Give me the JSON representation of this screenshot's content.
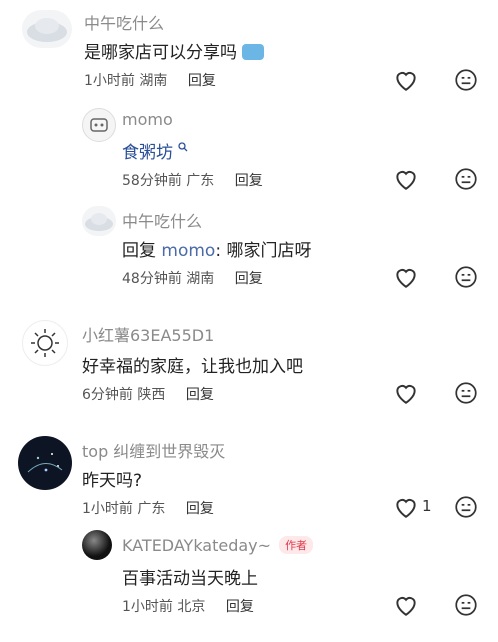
{
  "comments": [
    {
      "user": "中午吃什么",
      "text": "是哪家店可以分享吗",
      "time": "1小时前",
      "location": "湖南",
      "reply_label": "回复",
      "replies": [
        {
          "user": "momo",
          "text": "食粥坊",
          "time": "58分钟前",
          "location": "广东",
          "reply_label": "回复"
        },
        {
          "user": "中午吃什么",
          "reply_prefix": "回复",
          "mention": "momo",
          "text": ": 哪家门店呀",
          "time": "48分钟前",
          "location": "湖南",
          "reply_label": "回复"
        }
      ]
    },
    {
      "user": "小红薯63EA55D1",
      "text": "好幸福的家庭，让我也加入吧",
      "time": "6分钟前",
      "location": "陕西",
      "reply_label": "回复"
    },
    {
      "user": "top 纠缠到世界毁灭",
      "text": "昨天吗?",
      "time": "1小时前",
      "location": "广东",
      "reply_label": "回复",
      "like_count": "1",
      "replies": [
        {
          "user": "KATEDAYkateday~",
          "badge": "作者",
          "text": "百事活动当天晚上",
          "time": "1小时前",
          "location": "北京",
          "reply_label": "回复"
        }
      ]
    }
  ],
  "colors": {
    "text": "#222222",
    "name": "#8a8a8a",
    "badge": "#e03a4a",
    "link": "#2b4f9a"
  }
}
